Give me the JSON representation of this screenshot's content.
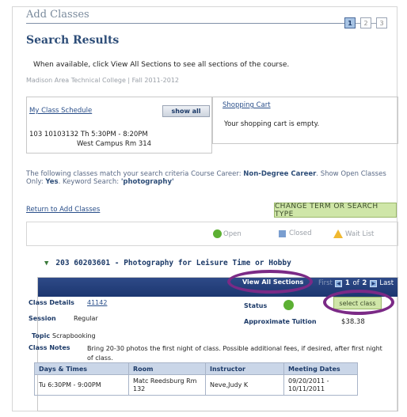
{
  "header": {
    "page_heading": "Add Classes",
    "steps": [
      "1",
      "2",
      "3"
    ],
    "active_step": "1"
  },
  "results_title": "Search Results",
  "info_text": "When available, click View All Sections to see all sections of the course.",
  "college_term": "Madison Area Technical College | Fall 2011-2012",
  "schedule": {
    "link": "My Class Schedule",
    "show_all_label": "show all",
    "line1": "103 10103132  Th 5:30PM - 8:20PM",
    "line2": "West Campus Rm 314"
  },
  "cart": {
    "link": "Shopping Cart",
    "message": "Your shopping cart is empty."
  },
  "criteria": {
    "prefix": "The following classes match your search criteria Course Career:",
    "career": "Non-Degree Career",
    "open_label": ". Show Open Classes Only:",
    "open_value": "Yes",
    "keyword_label": ". Keyword Search:",
    "keyword_value": "'photography'"
  },
  "return_link": "Return to Add Classes",
  "change_term_button": "CHANGE TERM OR SEARCH TYPE",
  "legend": {
    "open": "Open",
    "closed": "Closed",
    "wait_list": "Wait List"
  },
  "course": {
    "title": "203 60203601 - Photography for Leisure Time or Hobby",
    "view_all_sections": "View All Sections",
    "pager": {
      "first": "First",
      "current": "1",
      "of": "of",
      "total": "2",
      "last": "Last"
    },
    "class_details_label": "Class Details",
    "class_number": "41142",
    "session_label": "Session",
    "session_value": "Regular",
    "status_label": "Status",
    "tuition_label": "Approximate Tuition",
    "tuition_value": "$38.38",
    "select_button": "select class",
    "topic_label": "Topic",
    "topic_value": "Scrapbooking",
    "notes_label": "Class Notes",
    "notes_value": "Bring 20-30 photos the first night of class.  Possible additional fees, if desired, after first night of class.",
    "table": {
      "headers": [
        "Days & Times",
        "Room",
        "Instructor",
        "Meeting Dates"
      ],
      "row": {
        "days_times": "Tu 6:30PM - 9:00PM",
        "room": "Matc Reedsburg Rm 132",
        "instructor": "Neve,Judy K",
        "meeting_dates": "09/20/2011 - 10/11/2011"
      }
    }
  },
  "colors": {
    "accent_blue": "#1c3670",
    "open_green": "#5cb033",
    "annotation_purple": "#7b2a86",
    "button_green": "#cfe6a8"
  }
}
